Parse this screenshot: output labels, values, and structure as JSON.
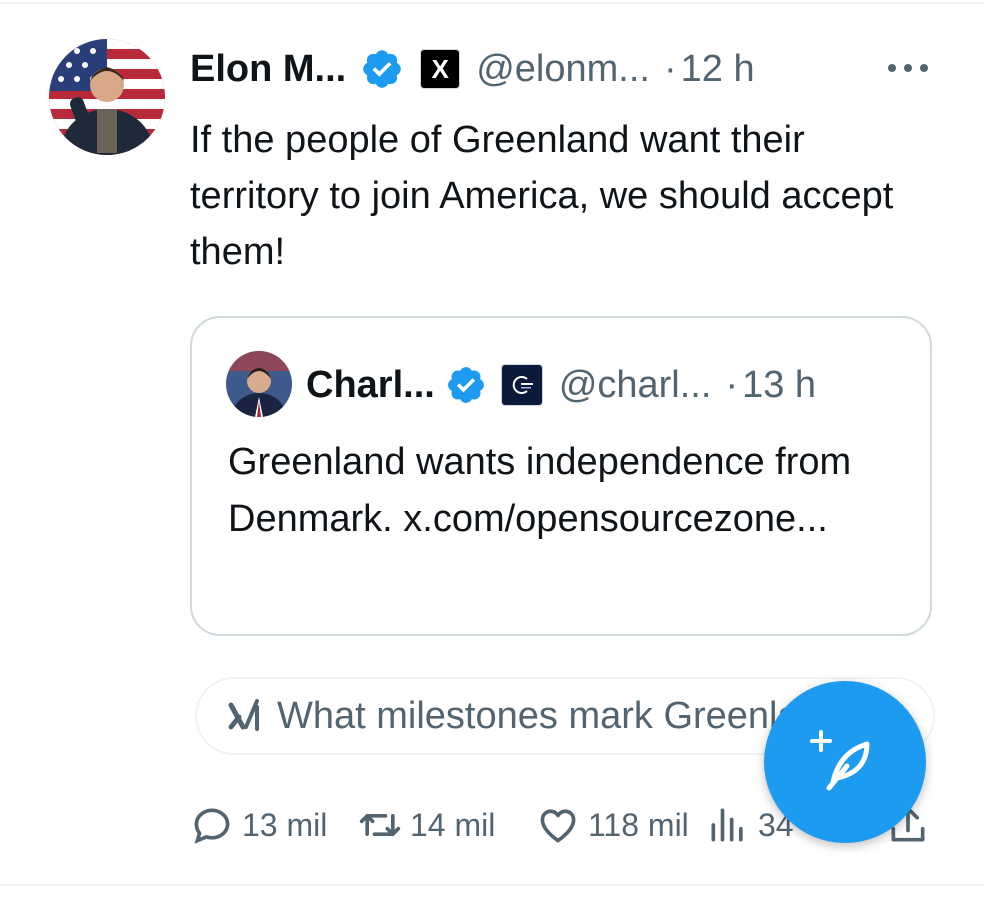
{
  "tweet": {
    "author_name": "Elon M...",
    "handle": "@elonm...",
    "separator": "·",
    "time": "12 h",
    "text": "If the people of Greenland want their territory to join America, we should accept them!",
    "affiliation_badge": "X",
    "verified_color": "#1d9bf0"
  },
  "quoted_tweet": {
    "author_name": "Charl...",
    "handle": "@charl...",
    "separator": "·",
    "time": "13 h",
    "text": "Greenland wants independence from Denmark. x.com/opensourcezone..."
  },
  "grok_prompt": {
    "text": "What milestones mark Greenlan"
  },
  "actions": {
    "replies": "13 mil",
    "reposts": "14 mil",
    "likes": "118 mil",
    "views": "34"
  },
  "colors": {
    "accent": "#1d9bf0",
    "text_primary": "#0f1419",
    "text_secondary": "#536471",
    "border": "#cfd9de"
  }
}
